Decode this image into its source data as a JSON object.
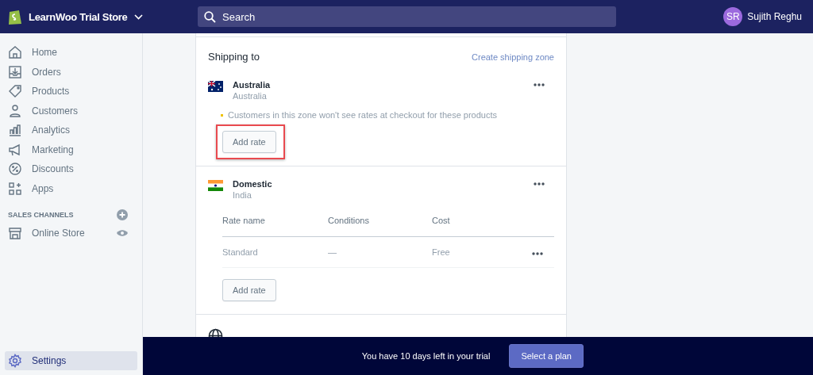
{
  "topbar": {
    "store_name": "LearnWoo Trial Store",
    "search": {
      "placeholder": "Search"
    },
    "user": {
      "initials": "SR",
      "name": "Sujith Reghu"
    }
  },
  "sidebar": {
    "items": [
      {
        "label": "Home",
        "selected": false
      },
      {
        "label": "Orders",
        "selected": false
      },
      {
        "label": "Products",
        "selected": false
      },
      {
        "label": "Customers",
        "selected": false
      },
      {
        "label": "Analytics",
        "selected": false
      },
      {
        "label": "Marketing",
        "selected": false
      },
      {
        "label": "Discounts",
        "selected": false
      },
      {
        "label": "Apps",
        "selected": false
      }
    ],
    "sales_channels": {
      "heading": "SALES CHANNELS",
      "items": [
        {
          "label": "Online Store",
          "selected": false
        }
      ]
    },
    "settings": {
      "label": "Settings",
      "selected": true
    }
  },
  "shipping": {
    "title": "Shipping to",
    "create_link": "Create shipping zone",
    "zones": [
      {
        "name": "Australia",
        "country": "Australia",
        "warning": "Customers in this zone won't see rates at checkout for these products",
        "button": "Add rate",
        "highlighted": true
      },
      {
        "name": "Domestic",
        "country": "India",
        "columns": [
          "Rate name",
          "Conditions",
          "Cost"
        ],
        "rows": [
          {
            "rate_name": "Standard",
            "conditions": "—",
            "cost": "Free"
          }
        ],
        "button": "Add rate",
        "highlighted": false
      }
    ]
  },
  "trial_banner": {
    "text": "You have 10 days left in your trial",
    "button": "Select a plan"
  }
}
